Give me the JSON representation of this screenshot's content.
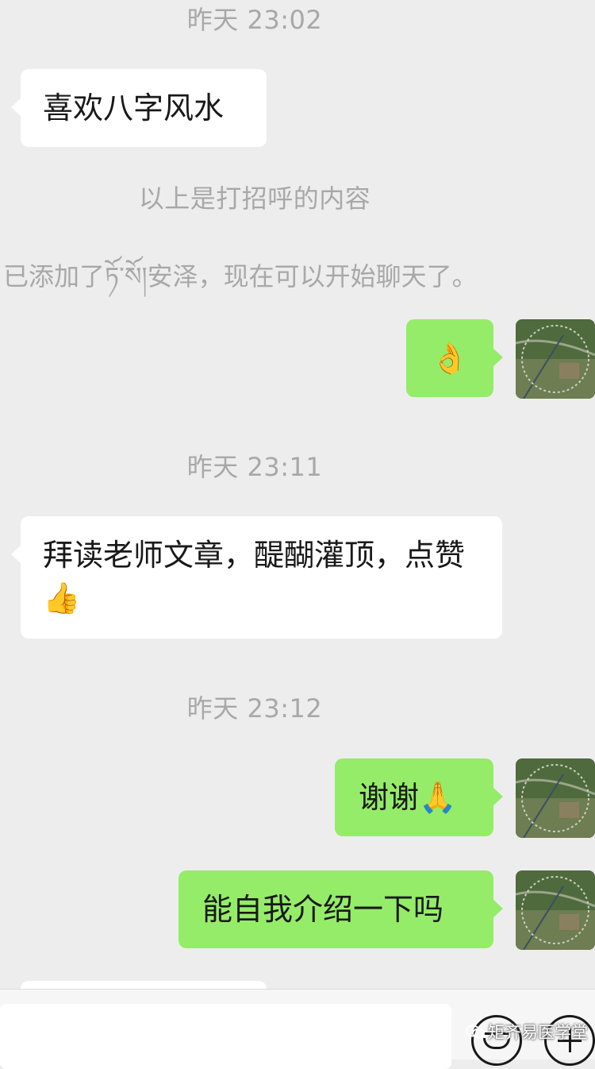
{
  "chat": {
    "ts1": "昨天 23:02",
    "msg_in_1": "喜欢八字风水",
    "sys_greeting": "以上是打招呼的内容",
    "sys_added": "已添加了ཏོ་སོ།安泽，现在可以开始聊天了。",
    "msg_out_1": "👌",
    "ts2": "昨天 23:11",
    "msg_in_2": "拜读老师文章，醍醐灌顶，点赞👍",
    "ts3": "昨天 23:12",
    "msg_out_2": "谢谢🙏",
    "msg_out_3": "能自我介绍一下吗"
  },
  "input": {
    "placeholder": ""
  },
  "watermark": {
    "text": "矩齐易医学堂"
  },
  "colors": {
    "background": "#ededed",
    "bubble_in": "#ffffff",
    "bubble_out": "#95ec69",
    "timestamp": "#a8a8a8"
  },
  "icons": {
    "emoji": "emoji-icon",
    "plus": "plus-icon",
    "avatar": "avatar-icon"
  }
}
